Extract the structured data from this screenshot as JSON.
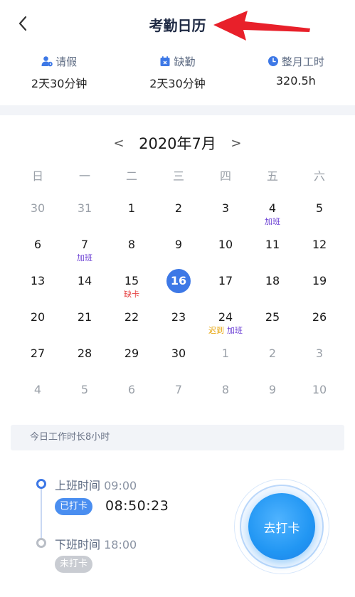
{
  "header": {
    "title": "考勤日历"
  },
  "stats": [
    {
      "label": "请假",
      "value": "2天30分钟",
      "icon": "user-leave-icon"
    },
    {
      "label": "缺勤",
      "value": "2天30分钟",
      "icon": "calendar-x-icon"
    },
    {
      "label": "整月工时",
      "value": "320.5h",
      "icon": "clock-icon"
    }
  ],
  "calendar": {
    "prev": "<",
    "next": ">",
    "month_label": "2020年7月",
    "weekdays": [
      "日",
      "一",
      "二",
      "三",
      "四",
      "五",
      "六"
    ],
    "weeks": [
      [
        {
          "day": "30",
          "other": true
        },
        {
          "day": "31",
          "other": true
        },
        {
          "day": "1"
        },
        {
          "day": "2"
        },
        {
          "day": "3"
        },
        {
          "day": "4",
          "tags": [
            {
              "text": "加班",
              "type": "jiaban"
            }
          ]
        },
        {
          "day": "5"
        }
      ],
      [
        {
          "day": "6"
        },
        {
          "day": "7",
          "tags": [
            {
              "text": "加班",
              "type": "jiaban"
            }
          ]
        },
        {
          "day": "8"
        },
        {
          "day": "9"
        },
        {
          "day": "10"
        },
        {
          "day": "11"
        },
        {
          "day": "12"
        }
      ],
      [
        {
          "day": "13"
        },
        {
          "day": "14"
        },
        {
          "day": "15",
          "tags": [
            {
              "text": "缺卡",
              "type": "queka"
            }
          ]
        },
        {
          "day": "16",
          "today": true
        },
        {
          "day": "17"
        },
        {
          "day": "18"
        },
        {
          "day": "19"
        }
      ],
      [
        {
          "day": "20"
        },
        {
          "day": "21"
        },
        {
          "day": "22"
        },
        {
          "day": "23"
        },
        {
          "day": "24",
          "tags": [
            {
              "text": "迟到",
              "type": "chidao"
            },
            {
              "text": "加班",
              "type": "jiaban"
            }
          ]
        },
        {
          "day": "25"
        },
        {
          "day": "26"
        }
      ],
      [
        {
          "day": "27"
        },
        {
          "day": "28"
        },
        {
          "day": "29"
        },
        {
          "day": "30"
        },
        {
          "day": "1",
          "other": true
        },
        {
          "day": "2",
          "other": true
        },
        {
          "day": "3",
          "other": true
        }
      ],
      [
        {
          "day": "4",
          "other": true
        },
        {
          "day": "5",
          "other": true
        },
        {
          "day": "6",
          "other": true
        },
        {
          "day": "7",
          "other": true
        },
        {
          "day": "8",
          "other": true
        },
        {
          "day": "9",
          "other": true
        },
        {
          "day": "10",
          "other": true
        }
      ]
    ]
  },
  "today_work": {
    "text": "今日工作时长8小时"
  },
  "clock_in": {
    "label": "上班时间",
    "time": "09:00",
    "status": "已打卡",
    "punched_time": "08:50:23"
  },
  "clock_out": {
    "label": "下班时间",
    "time": "18:00",
    "status": "未打卡"
  },
  "punch_button": {
    "label": "去打卡"
  },
  "colors": {
    "accent": "#3d78e6",
    "punch": "#2196f3",
    "overtime": "#6b3fd4",
    "missing": "#e64545",
    "late": "#e6a100",
    "annotation_arrow": "#e8202a"
  }
}
